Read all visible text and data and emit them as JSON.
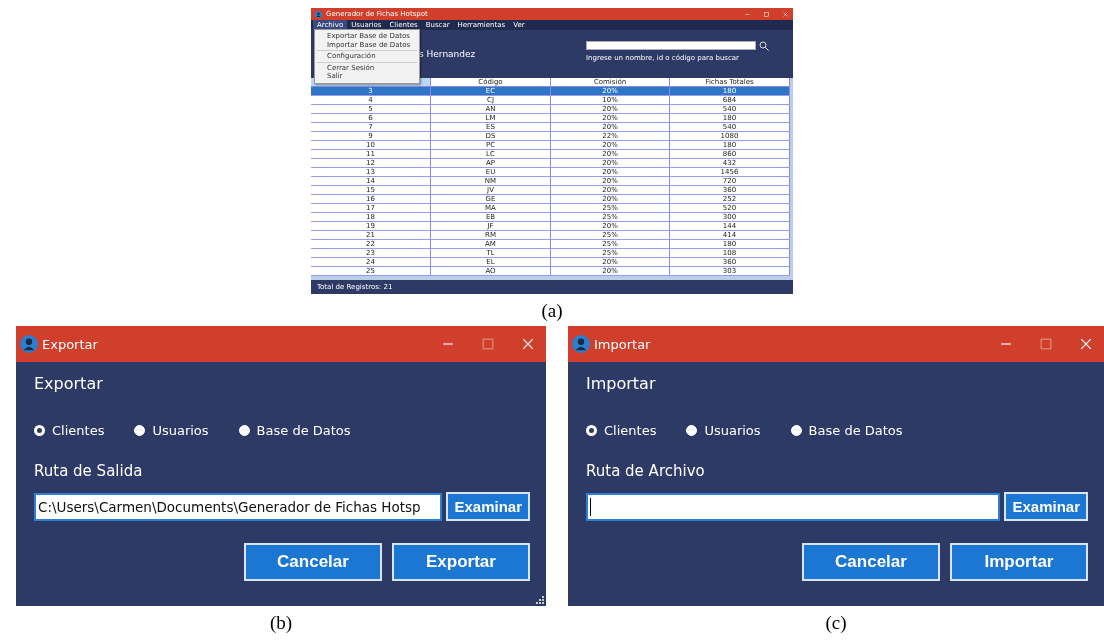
{
  "main_window": {
    "title": "Generador de Fichas Hotspot",
    "menu": [
      {
        "label": "Archivo",
        "selected": true
      },
      {
        "label": "Usuarios",
        "selected": false
      },
      {
        "label": "Clientes",
        "selected": false
      },
      {
        "label": "Buscar",
        "selected": false
      },
      {
        "label": "Herramientas",
        "selected": false
      },
      {
        "label": "Ver",
        "selected": false
      }
    ],
    "dropdown": [
      {
        "kind": "item",
        "label": "Exportar Base de Datos"
      },
      {
        "kind": "item",
        "label": "Importar Base de Datos"
      },
      {
        "kind": "separator"
      },
      {
        "kind": "item",
        "label": "Configuración"
      },
      {
        "kind": "separator"
      },
      {
        "kind": "item",
        "label": "Cerrar Sesión"
      },
      {
        "kind": "item",
        "label": "Salir"
      }
    ],
    "user_name": "s Hernandez",
    "search_hint": "Ingrese un nombre, id o código para buscar",
    "table": {
      "columns": [
        "",
        "Código",
        "Comisión",
        "Fichas Totales"
      ],
      "rows": [
        {
          "cells": [
            "3",
            "EC",
            "20%",
            "180"
          ],
          "selected": true
        },
        {
          "cells": [
            "4",
            "CJ",
            "10%",
            "684"
          ],
          "selected": false
        },
        {
          "cells": [
            "5",
            "AN",
            "20%",
            "540"
          ],
          "selected": false
        },
        {
          "cells": [
            "6",
            "LM",
            "20%",
            "180"
          ],
          "selected": false
        },
        {
          "cells": [
            "7",
            "ES",
            "20%",
            "540"
          ],
          "selected": false
        },
        {
          "cells": [
            "9",
            "DS",
            "22%",
            "1080"
          ],
          "selected": false
        },
        {
          "cells": [
            "10",
            "PC",
            "20%",
            "180"
          ],
          "selected": false
        },
        {
          "cells": [
            "11",
            "LC",
            "20%",
            "860"
          ],
          "selected": false
        },
        {
          "cells": [
            "12",
            "AP",
            "20%",
            "432"
          ],
          "selected": false
        },
        {
          "cells": [
            "13",
            "EU",
            "20%",
            "1456"
          ],
          "selected": false
        },
        {
          "cells": [
            "14",
            "NM",
            "20%",
            "720"
          ],
          "selected": false
        },
        {
          "cells": [
            "15",
            "JV",
            "20%",
            "360"
          ],
          "selected": false
        },
        {
          "cells": [
            "16",
            "GE",
            "20%",
            "252"
          ],
          "selected": false
        },
        {
          "cells": [
            "17",
            "MA",
            "25%",
            "520"
          ],
          "selected": false
        },
        {
          "cells": [
            "18",
            "EB",
            "25%",
            "300"
          ],
          "selected": false
        },
        {
          "cells": [
            "19",
            "JF",
            "20%",
            "144"
          ],
          "selected": false
        },
        {
          "cells": [
            "21",
            "RM",
            "25%",
            "414"
          ],
          "selected": false
        },
        {
          "cells": [
            "22",
            "AM",
            "25%",
            "180"
          ],
          "selected": false
        },
        {
          "cells": [
            "23",
            "TL",
            "25%",
            "108"
          ],
          "selected": false
        },
        {
          "cells": [
            "24",
            "EL",
            "20%",
            "360"
          ],
          "selected": false
        },
        {
          "cells": [
            "25",
            "AO",
            "20%",
            "303"
          ],
          "selected": false
        }
      ]
    },
    "status_bar": "Total de Registros: 21",
    "caption": "(a)"
  },
  "dialogs": [
    {
      "title": "Exportar",
      "heading": "Exportar",
      "options": [
        {
          "label": "Clientes",
          "selected": true
        },
        {
          "label": "Usuarios",
          "selected": false
        },
        {
          "label": "Base de Datos",
          "selected": false
        }
      ],
      "path_label": "Ruta de Salida",
      "path_value": "C:\\Users\\Carmen\\Documents\\Generador de Fichas Hotsp",
      "browse_button": "Examinar",
      "buttons": [
        "Cancelar",
        "Exportar"
      ],
      "caption": "(b)"
    },
    {
      "title": "Importar",
      "heading": "Importar",
      "options": [
        {
          "label": "Clientes",
          "selected": true
        },
        {
          "label": "Usuarios",
          "selected": false
        },
        {
          "label": "Base de Datos",
          "selected": false
        }
      ],
      "path_label": "Ruta de Archivo",
      "browse_button": "Examinar",
      "buttons": [
        "Cancelar",
        "Importar"
      ],
      "caption": "(c)"
    }
  ]
}
